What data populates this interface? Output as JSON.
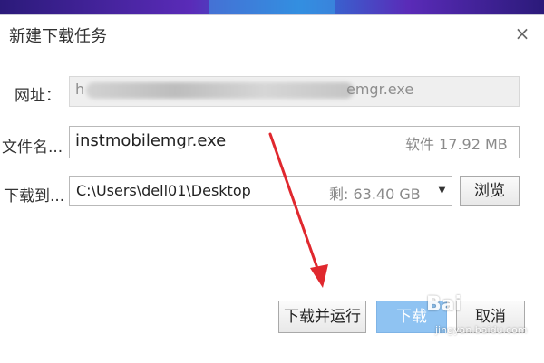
{
  "dialog": {
    "title": "新建下载任务",
    "close_symbol": "×"
  },
  "url_row": {
    "label": "网址：",
    "value_visible_prefix": "h",
    "value_visible_suffix": "emgr.exe"
  },
  "filename_row": {
    "label": "文件名...",
    "value": "instmobilemgr.exe",
    "size_text": "软件 17.92 MB"
  },
  "download_to_row": {
    "label": "下载到...",
    "path": "C:\\Users\\dell01\\Desktop",
    "free_space": "剩: 63.40 GB",
    "dropdown_symbol": "▼",
    "browse_label": "浏览"
  },
  "buttons": {
    "download_and_run": "下载并运行",
    "download": "下载",
    "cancel": "取消"
  },
  "watermark": {
    "brand": "Bai",
    "url": "jingyan.baidu.com"
  },
  "colors": {
    "annotation_arrow": "#e0282e",
    "primary_button": "#8fc3f2"
  },
  "icons": {
    "close": "close-icon",
    "dropdown": "chevron-down-icon"
  }
}
